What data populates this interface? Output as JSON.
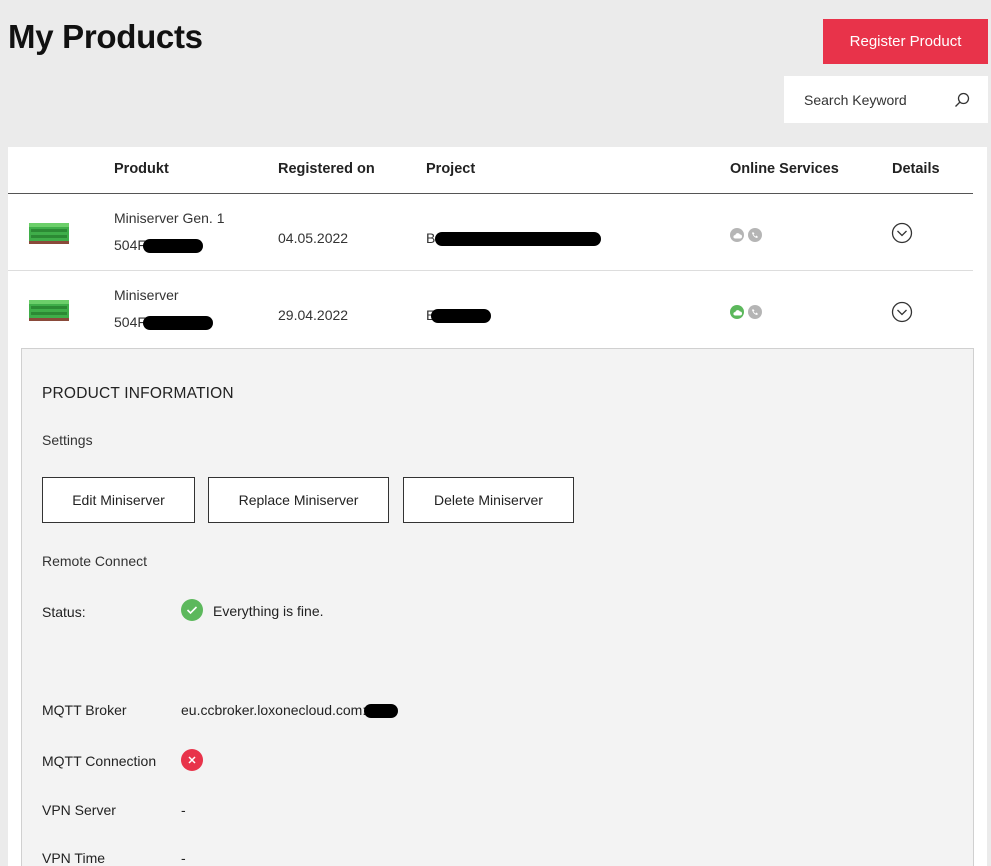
{
  "page": {
    "title": "My Products"
  },
  "header": {
    "register_label": "Register Product",
    "search_placeholder": "Search Keyword"
  },
  "table": {
    "columns": [
      "Produkt",
      "Registered on",
      "Project",
      "Online Services",
      "Details"
    ],
    "rows": [
      {
        "name": "Miniserver Gen. 1",
        "serial_visible": "504F",
        "registered": "04.05.2022",
        "project_visible": "Ba",
        "services": [
          "grey",
          "grey"
        ]
      },
      {
        "name": "Miniserver",
        "serial_visible": "504F",
        "registered": "29.04.2022",
        "project_visible": "E",
        "services": [
          "green",
          "grey"
        ]
      }
    ]
  },
  "details": {
    "section_title": "PRODUCT INFORMATION",
    "settings_label": "Settings",
    "buttons": {
      "edit": "Edit Miniserver",
      "replace": "Replace Miniserver",
      "delete": "Delete Miniserver"
    },
    "remote_connect_label": "Remote Connect",
    "status": {
      "label": "Status:",
      "value": "Everything is fine."
    },
    "mqtt_broker": {
      "label": "MQTT Broker",
      "value": "eu.ccbroker.loxonecloud.com:"
    },
    "mqtt_connection": {
      "label": "MQTT Connection"
    },
    "vpn_server": {
      "label": "VPN Server",
      "value": "-"
    },
    "vpn_time": {
      "label": "VPN Time",
      "value": "-"
    }
  },
  "colors": {
    "accent": "#e8334a",
    "ok": "#5cb85c",
    "service_active": "#5cb85c",
    "service_inactive": "#b5b5b5"
  }
}
